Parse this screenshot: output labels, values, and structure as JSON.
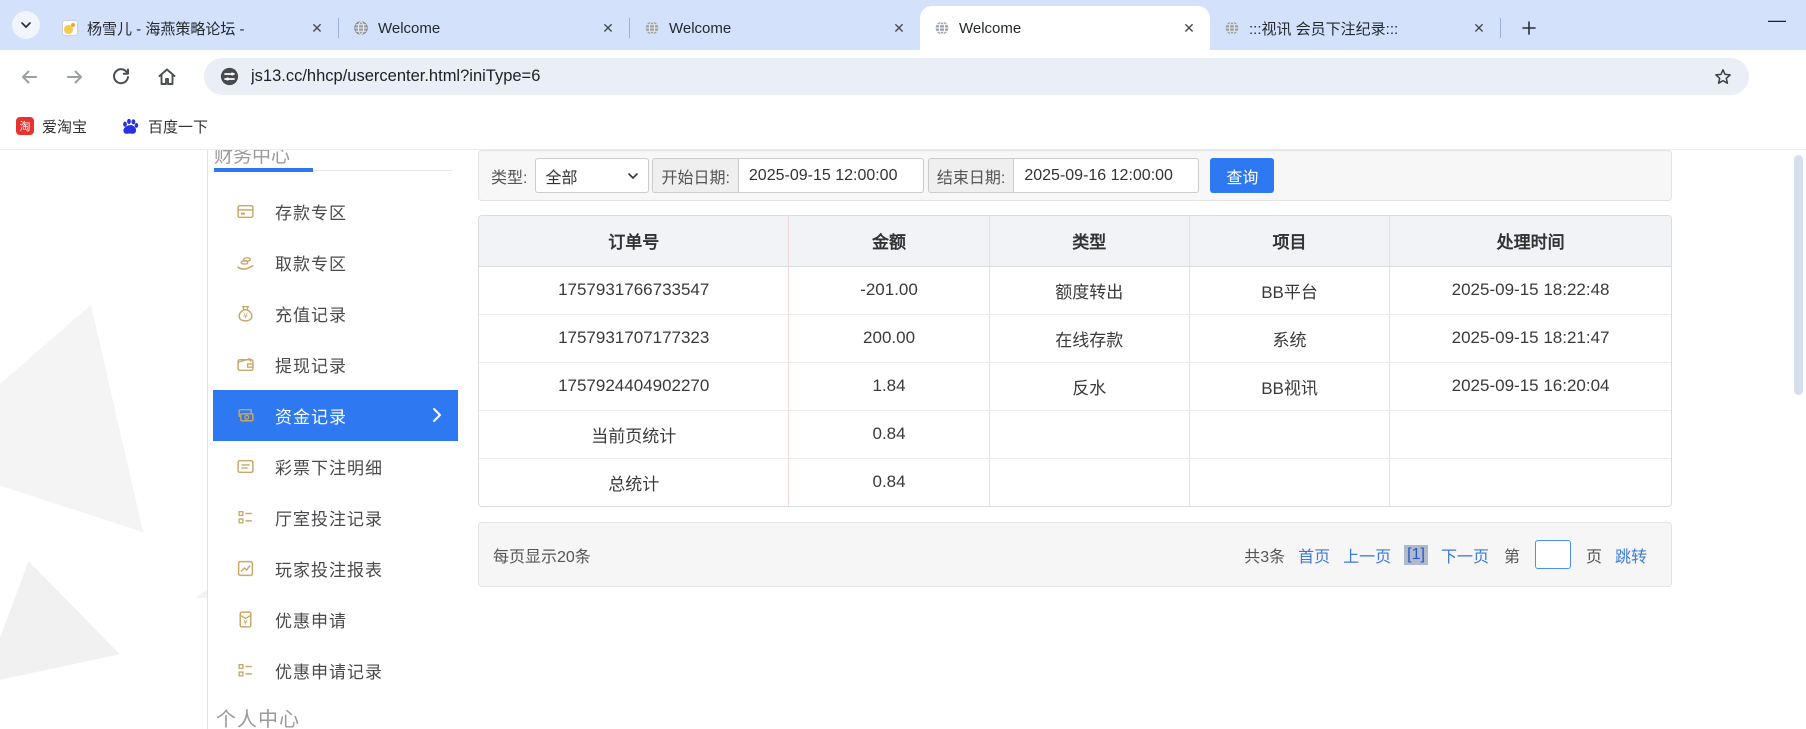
{
  "browser": {
    "tabs": [
      {
        "title": "杨雪儿 - 海燕策略论坛 -",
        "active": false,
        "favicon": "page-icon"
      },
      {
        "title": "Welcome",
        "active": false,
        "favicon": "globe-icon"
      },
      {
        "title": "Welcome",
        "active": false,
        "favicon": "globe-icon"
      },
      {
        "title": "Welcome",
        "active": true,
        "favicon": "globe-icon"
      },
      {
        "title": ":::视讯 会员下注纪录:::",
        "active": false,
        "favicon": "globe-icon"
      }
    ],
    "new_tab_label": "+",
    "minimize_label": "—",
    "url": "js13.cc/hhcp/usercenter.html?iniType=6",
    "bookmarks": [
      {
        "label": "爱淘宝",
        "icon": "taobao-icon",
        "icon_glyph": "淘"
      },
      {
        "label": "百度一下",
        "icon": "baidu-paw-icon"
      }
    ]
  },
  "sidebar": {
    "section_top": "财务中心",
    "section_bottom": "个人中心",
    "items": [
      {
        "label": "存款专区",
        "icon": "deposit-card-icon",
        "active": false
      },
      {
        "label": "取款专区",
        "icon": "withdraw-hand-icon",
        "active": false
      },
      {
        "label": "充值记录",
        "icon": "moneybag-icon",
        "active": false
      },
      {
        "label": "提现记录",
        "icon": "wallet-icon",
        "active": false
      },
      {
        "label": "资金记录",
        "icon": "banknotes-icon",
        "active": true
      },
      {
        "label": "彩票下注明细",
        "icon": "list-card-icon",
        "active": false
      },
      {
        "label": "厅室投注记录",
        "icon": "checklist-icon",
        "active": false
      },
      {
        "label": "玩家投注报表",
        "icon": "report-chart-icon",
        "active": false
      },
      {
        "label": "优惠申请",
        "icon": "red-envelope-icon",
        "active": false
      },
      {
        "label": "优惠申请记录",
        "icon": "checklist-icon",
        "active": false
      }
    ]
  },
  "filters": {
    "type_label": "类型:",
    "type_value": "全部",
    "start_label": "开始日期:",
    "start_value": "2025-09-15 12:00:00",
    "end_label": "结束日期:",
    "end_value": "2025-09-16 12:00:00",
    "query_button": "查询"
  },
  "table": {
    "columns": [
      "订单号",
      "金额",
      "类型",
      "项目",
      "处理时间"
    ],
    "rows": [
      [
        "1757931766733547",
        "-201.00",
        "额度转出",
        "BB平台",
        "2025-09-15 18:22:48"
      ],
      [
        "1757931707177323",
        "200.00",
        "在线存款",
        "系统",
        "2025-09-15 18:21:47"
      ],
      [
        "1757924404902270",
        "1.84",
        "反水",
        "BB视讯",
        "2025-09-15 16:20:04"
      ],
      [
        "当前页统计",
        "0.84",
        "",
        "",
        ""
      ],
      [
        "总统计",
        "0.84",
        "",
        "",
        ""
      ]
    ]
  },
  "pagination": {
    "page_size_text": "每页显示20条",
    "total_text": "共3条",
    "first_label": "首页",
    "prev_label": "上一页",
    "current_page": "[1]",
    "next_label": "下一页",
    "page_prefix": "第",
    "page_suffix": "页",
    "jump_label": "跳转",
    "page_input_value": ""
  },
  "colors": {
    "accent_blue": "#2e79f2",
    "link_blue": "#3e7ad8",
    "gold_icon": "#c9a86a",
    "tabstrip_bg": "#d3e1fb"
  }
}
